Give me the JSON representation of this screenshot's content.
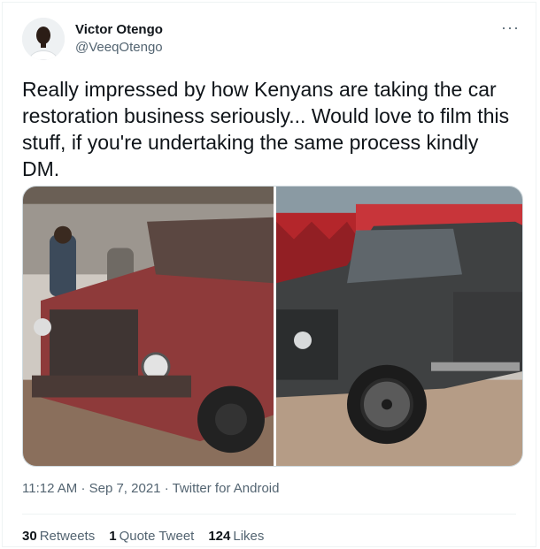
{
  "author": {
    "name": "Victor Otengo",
    "handle": "@VeeqOtengo"
  },
  "menu_icon": "more-horizontal-icon",
  "tweet": {
    "text": "Really impressed by how Kenyans are taking the car restoration business seriously... Would love to film this stuff, if you're undertaking the same process kindly DM."
  },
  "media": [
    {
      "description": "red rusty SUV before restoration",
      "icon": "photo"
    },
    {
      "description": "black restored SUV",
      "icon": "photo"
    }
  ],
  "meta": {
    "time": "11:12 AM",
    "separator1": "·",
    "date": "Sep 7, 2021",
    "separator2": "·",
    "source": "Twitter for Android"
  },
  "stats": {
    "retweets_count": "30",
    "retweets_label": "Retweets",
    "quotes_count": "1",
    "quotes_label": "Quote Tweet",
    "likes_count": "124",
    "likes_label": "Likes"
  },
  "colors": {
    "text": "#0f1419",
    "secondary": "#536471",
    "border": "#eff3f4"
  }
}
